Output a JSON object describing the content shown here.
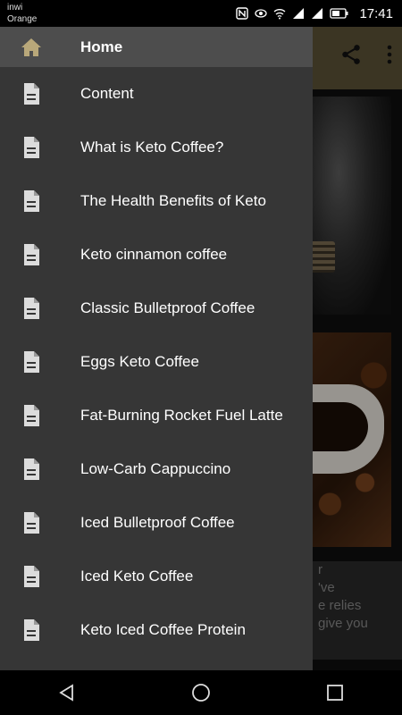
{
  "status_bar": {
    "carrier_primary": "inwi",
    "carrier_secondary": "Orange",
    "time": "17:41",
    "icons": [
      "nfc-icon",
      "eye-icon",
      "wifi-icon",
      "signal-icon",
      "signal-icon",
      "battery-icon"
    ]
  },
  "drawer": {
    "items": [
      {
        "label": "Home",
        "icon": "home-icon",
        "active": true
      },
      {
        "label": "Content",
        "icon": "document-icon"
      },
      {
        "label": "What is Keto Coffee?",
        "icon": "document-icon"
      },
      {
        "label": "The Health Benefits of Keto",
        "icon": "document-icon"
      },
      {
        "label": "Keto cinnamon coffee",
        "icon": "document-icon"
      },
      {
        "label": "Classic Bulletproof Coffee",
        "icon": "document-icon"
      },
      {
        "label": "Eggs Keto Coffee",
        "icon": "document-icon"
      },
      {
        "label": "Fat-Burning Rocket Fuel Latte",
        "icon": "document-icon"
      },
      {
        "label": "Low-Carb Cappuccino",
        "icon": "document-icon"
      },
      {
        "label": "Iced Bulletproof Coffee",
        "icon": "document-icon"
      },
      {
        "label": "Iced Keto Coffee",
        "icon": "document-icon"
      },
      {
        "label": "Keto Iced Coffee Protein",
        "icon": "document-icon"
      }
    ]
  },
  "background_card": {
    "text_lines": [
      "r",
      "'ve",
      "e relies",
      "give you"
    ]
  },
  "appbar": {
    "actions": [
      "share-icon",
      "more-vert-icon"
    ]
  },
  "colors": {
    "appbar": "#5b5236",
    "drawer_bg": "#363636",
    "drawer_active": "#4d4d4d",
    "home_icon": "#b9a87a",
    "doc_icon": "#dcdcdc"
  }
}
